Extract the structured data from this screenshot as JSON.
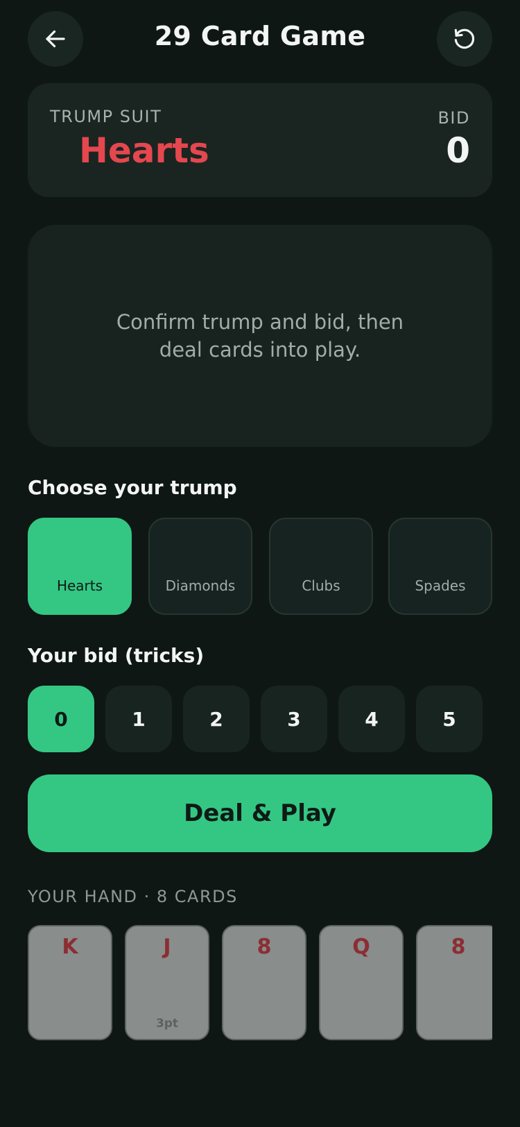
{
  "header": {
    "title": "29 Card Game",
    "back_icon": "arrow-left-icon",
    "reset_icon": "rotate-ccw-icon"
  },
  "summary": {
    "trump_label": "TRUMP SUIT",
    "trump_value": "Hearts",
    "bid_label": "BID",
    "bid_value": "0"
  },
  "play_area": {
    "message": "Confirm trump and bid, then deal cards into play."
  },
  "trump_section": {
    "title": "Choose your trump",
    "options": [
      "Hearts",
      "Diamonds",
      "Clubs",
      "Spades"
    ],
    "selected": "Hearts"
  },
  "bid_section": {
    "title": "Your bid (tricks)",
    "options": [
      "0",
      "1",
      "2",
      "3",
      "4",
      "5"
    ],
    "selected": "0"
  },
  "deal_button": {
    "label": "Deal & Play"
  },
  "hand": {
    "label": "YOUR HAND · 8 CARDS",
    "cards": [
      {
        "rank": "K",
        "points": ""
      },
      {
        "rank": "J",
        "points": "3pt"
      },
      {
        "rank": "8",
        "points": ""
      },
      {
        "rank": "Q",
        "points": ""
      },
      {
        "rank": "8",
        "points": ""
      }
    ]
  },
  "colors": {
    "accent": "#34c784",
    "hearts": "#e5474f",
    "background": "#0f1714",
    "surface": "#1a2521"
  }
}
